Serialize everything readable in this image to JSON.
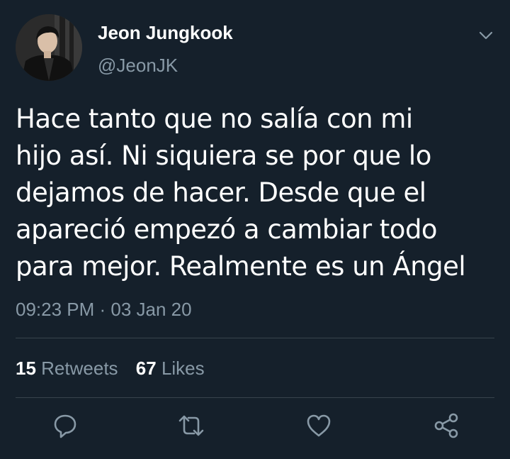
{
  "user": {
    "display_name": "Jeon Jungkook",
    "handle": "@JeonJK"
  },
  "tweet": {
    "text": "Hace tanto que no salía con mi\nhijo así. Ni siquiera se por que lo\ndejamos de hacer. Desde que el\napareció empezó a cambiar todo\npara mejor. Realmente es un Ángel",
    "timestamp": "09:23 PM · 03 Jan 20"
  },
  "stats": {
    "retweets_count": "15",
    "retweets_label": "Retweets",
    "likes_count": "67",
    "likes_label": "Likes"
  },
  "actions": [
    "reply-icon",
    "retweet-icon",
    "like-icon",
    "share-icon"
  ],
  "colors": {
    "background": "#15202b",
    "secondary_text": "#8899a6",
    "divider": "#38444d"
  }
}
